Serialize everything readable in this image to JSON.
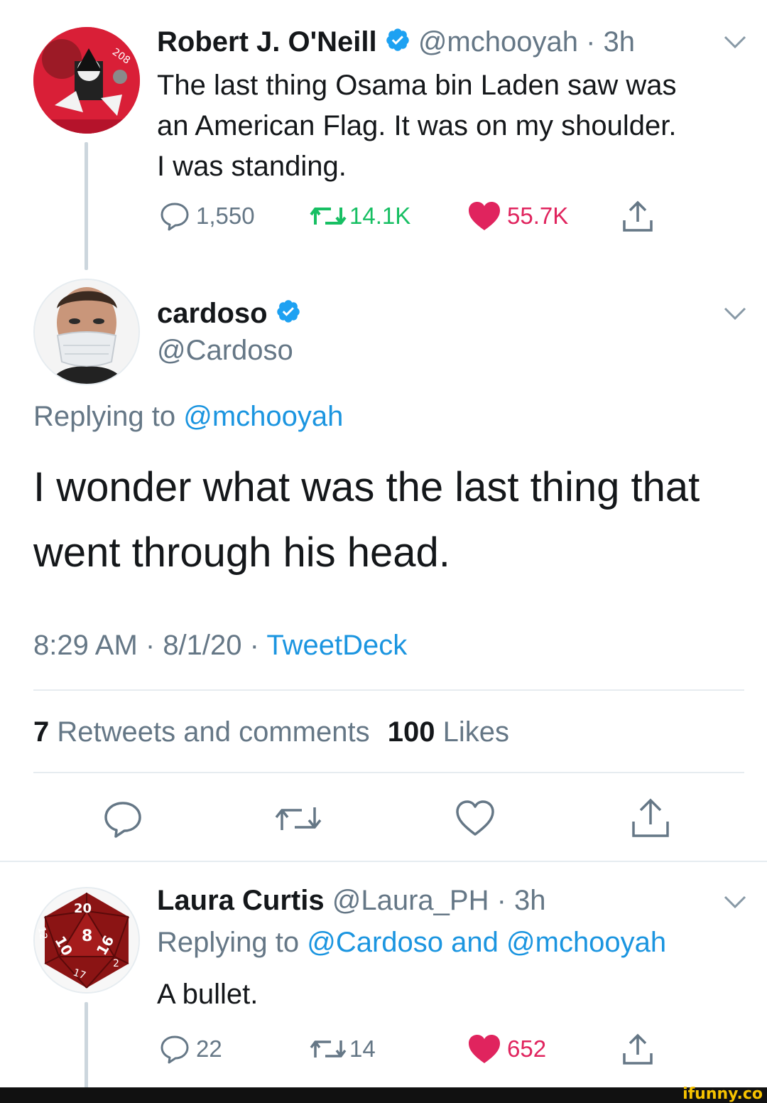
{
  "tweet1": {
    "name": "Robert J. O'Neill",
    "handle": "@mchooyah",
    "time": "3h",
    "text_lines": [
      "The last thing Osama bin Laden saw was",
      "an American Flag. It was on my shoulder.",
      "I was standing."
    ],
    "replies": "1,550",
    "retweets": "14.1K",
    "likes": "55.7K",
    "avatar_badge": "208"
  },
  "main_tweet": {
    "name": "cardoso",
    "handle": "@Cardoso",
    "replying_label": "Replying to",
    "replying_to": "@mchooyah",
    "text_lines": [
      "I wonder what was the last thing that",
      "went through his head."
    ],
    "time": "8:29 AM",
    "date": "8/1/20",
    "source": "TweetDeck",
    "retweets_count": "7",
    "retweets_label": "Retweets and comments",
    "likes_count": "100",
    "likes_label": "Likes"
  },
  "tweet3": {
    "name": "Laura Curtis",
    "handle": "@Laura_PH",
    "time": "3h",
    "replying_label": "Replying to",
    "replying_to": "@Cardoso and @mchooyah",
    "text": "A bullet.",
    "replies": "22",
    "retweets": "14",
    "likes": "652",
    "dice_numbers": [
      "20",
      "8",
      "10",
      "16",
      "12",
      "17",
      "2"
    ]
  },
  "sep": " · ",
  "watermark": "ifunny.co",
  "colors": {
    "accent": "#1b95e0",
    "verified": "#1da1f2",
    "like": "#e0245e",
    "retweet": "#17bf63",
    "muted": "#657786"
  },
  "icons": [
    "verified-badge-icon",
    "chevron-down-icon",
    "reply-icon",
    "retweet-icon",
    "heart-icon",
    "share-icon"
  ]
}
